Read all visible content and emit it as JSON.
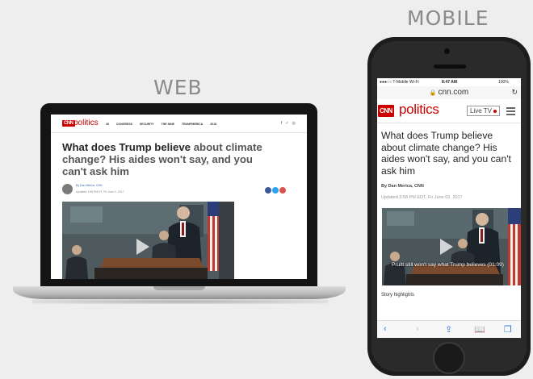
{
  "headings": {
    "web": "WEB",
    "mobile": "MOBILE"
  },
  "web": {
    "logo": "CNN",
    "section": "politics",
    "nav_items": [
      "45",
      "CONGRESS",
      "SECURITY",
      "THE NINE",
      "TRUMPMERICA",
      "2018"
    ],
    "social": [
      "f",
      "✓",
      "◎"
    ],
    "headline_main": "What does Trump believe ",
    "headline_dim": "about climate change? His aides won't say, and you can't ask him",
    "byline": "By Dan Merica, CNN",
    "updated": "Updated 3:58 PM ET, Fri June 2, 2017"
  },
  "mobile": {
    "status": {
      "carrier": "●●●○○ T-Mobile Wi-Fi",
      "time": "8:47 AM",
      "battery": "100%"
    },
    "url": "cnn.com",
    "logo": "CNN",
    "section": "politics",
    "live_tv": "Live TV",
    "headline": "What does Trump believe about climate change? His aides won't say, and you can't ask him",
    "byline": "By Dan Merica, CNN",
    "updated": "Updated 3:58 PM EDT, Fri June 02, 2017",
    "video_caption": "Pruitt still won't say what Trump believes (01:09)",
    "story_highlights": "Story highlights"
  },
  "colors": {
    "brand": "#cc0000",
    "ios_blue": "#2f7bd9"
  }
}
